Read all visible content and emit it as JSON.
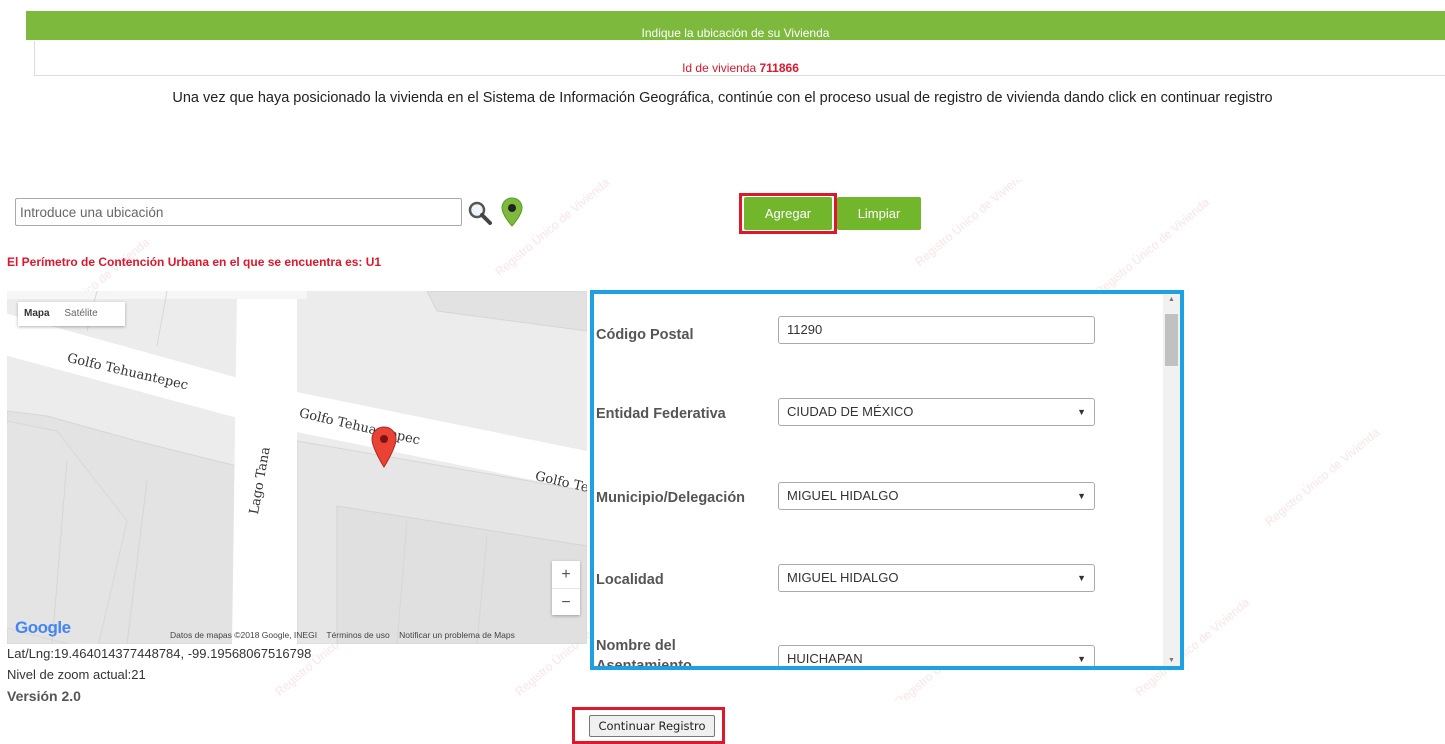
{
  "header": {
    "banner": "Indique la ubicación de su Vivienda",
    "id_label": "Id de vivienda",
    "id_value": "711866"
  },
  "instructions": "Una vez que haya posicionado la vivienda en el Sistema de Información Geográfica, continúe con el proceso usual de registro de vivienda dando click en continuar registro",
  "search": {
    "placeholder": "Introduce una ubicación",
    "value": ""
  },
  "buttons": {
    "agregar": "Agregar",
    "limpiar": "Limpiar",
    "continuar": "Continuar Registro"
  },
  "perimeter_text": "El Perímetro de Contención Urbana en el que se encuentra es: U1",
  "map": {
    "type_map": "Mapa",
    "type_satellite": "Satélite",
    "streets": [
      "Golfo Tehuantepec",
      "Golfo Tehuantepec",
      "Lago Tana",
      "Golfo Te"
    ],
    "zoom_in": "+",
    "zoom_out": "−",
    "logo": "Google",
    "attribution": "Datos de mapas ©2018 Google, INEGI",
    "terms": "Términos de uso",
    "report": "Notificar un problema de Maps"
  },
  "coords_text": "Lat/Lng:19.464014377448784, -99.19568067516798",
  "zoom_text": "Nivel de zoom actual:21",
  "version": "Versión 2.0",
  "form": {
    "postal_label": "Código Postal",
    "postal_value": "11290",
    "entidad_label": "Entidad Federativa",
    "entidad_value": "CIUDAD DE MÉXICO",
    "municipio_label": "Municipio/Delegación",
    "municipio_value": "MIGUEL HIDALGO",
    "localidad_label": "Localidad",
    "localidad_value": "MIGUEL HIDALGO",
    "asentamiento_label": "Nombre del Asentamiento",
    "asentamiento_value": "HUICHAPAN"
  },
  "watermark": "Registro Único de Vivienda",
  "colors": {
    "banner_green": "#7cb93c",
    "button_green": "#72b62c",
    "alert_red": "#e0162b",
    "highlight_blue": "#1ea1e0"
  }
}
